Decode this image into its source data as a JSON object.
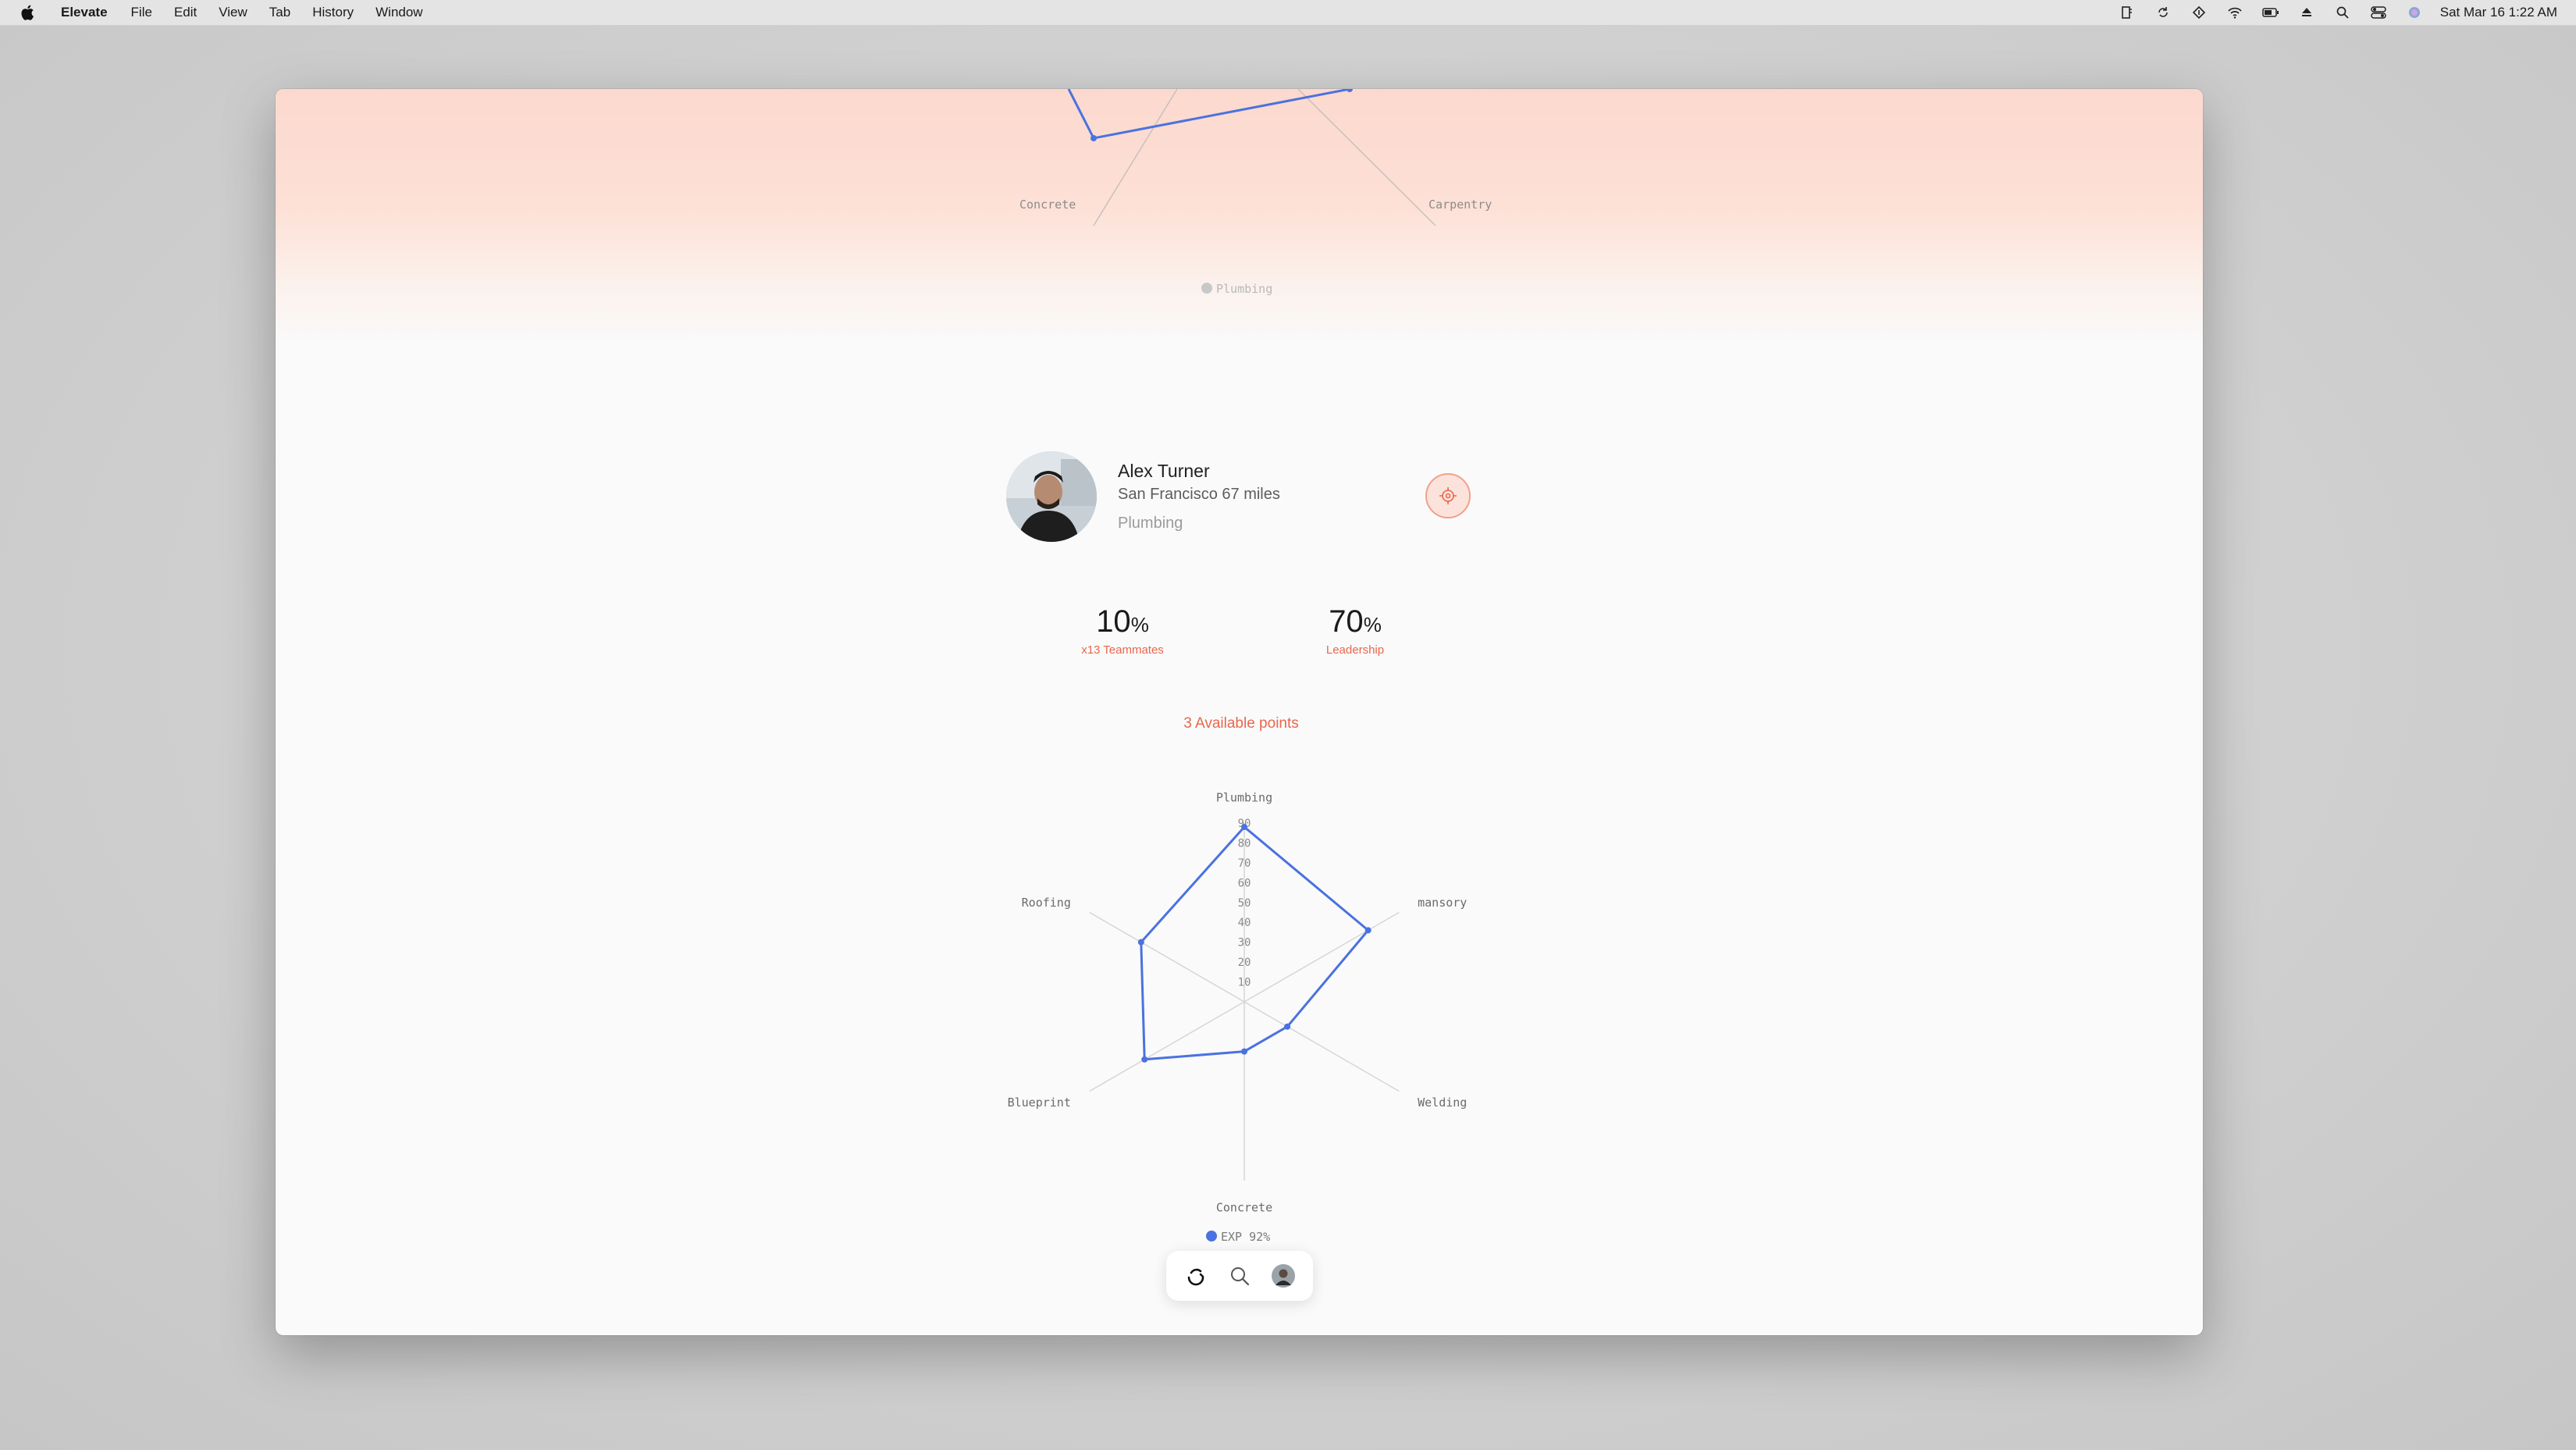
{
  "menubar": {
    "app_name": "Elevate",
    "menus": [
      "File",
      "Edit",
      "View",
      "Tab",
      "History",
      "Window"
    ],
    "clock": "Sat Mar 16  1:22 AM"
  },
  "top_chart": {
    "labels": {
      "left": "Concrete",
      "right": "Carpentry"
    },
    "legend": "Plumbing"
  },
  "profile": {
    "name": "Alex Turner",
    "location": "San Francisco 67 miles",
    "trade": "Plumbing"
  },
  "stats": [
    {
      "value": "10",
      "unit": "%",
      "label": "x13 Teammates"
    },
    {
      "value": "70",
      "unit": "%",
      "label": "Leadership"
    }
  ],
  "available_points": "3 Available points",
  "colors": {
    "accent": "#e8674c",
    "series": "#4a72e0",
    "banner": "#fcd9ce"
  },
  "chart_data": {
    "type": "radar",
    "axes": [
      "Plumbing",
      "mansory",
      "Welding",
      "Concrete",
      "Blueprint",
      "Roofing"
    ],
    "ticks": [
      "10",
      "20",
      "30",
      "40",
      "50",
      "60",
      "70",
      "80",
      "90"
    ],
    "rlim": [
      0,
      90
    ],
    "series": [
      {
        "name": "EXP",
        "values": [
          88,
          72,
          25,
          25,
          58,
          60
        ]
      }
    ],
    "legend": "EXP 92%",
    "legend_position": "bottom"
  },
  "dock": {
    "items": [
      "home-logo-icon",
      "search-icon",
      "profile-avatar-icon"
    ]
  }
}
